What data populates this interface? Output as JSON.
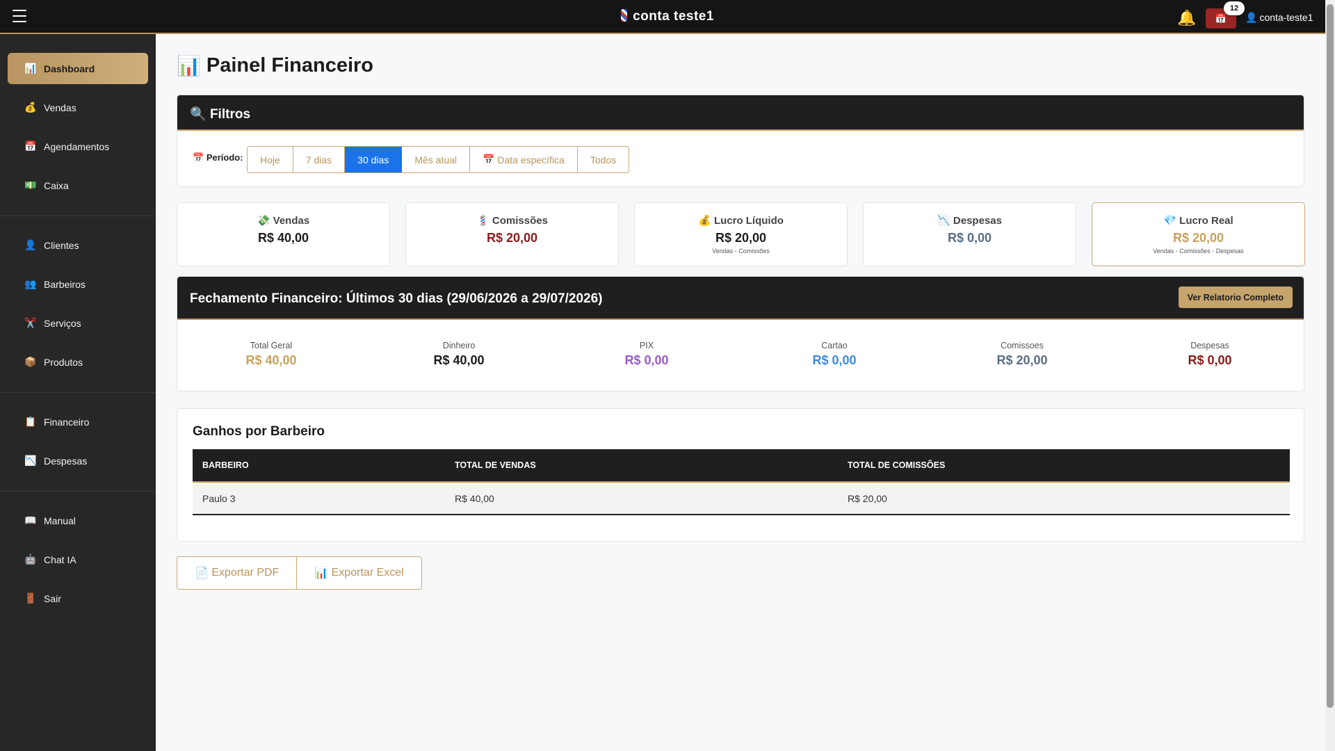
{
  "topbar": {
    "brand": "conta teste1",
    "notifications_count": "12",
    "user": "conta-teste1"
  },
  "sidebar": {
    "items": [
      {
        "label": "Dashboard",
        "icon": "bar-chart-icon",
        "glyph": "📊",
        "active": true
      },
      {
        "label": "Vendas",
        "icon": "money-bag-icon",
        "glyph": "💰"
      },
      {
        "label": "Agendamentos",
        "icon": "calendar-icon",
        "glyph": "📅"
      },
      {
        "label": "Caixa",
        "icon": "cash-icon",
        "glyph": "💵"
      },
      {
        "label": "Clientes",
        "icon": "user-icon",
        "glyph": "👤"
      },
      {
        "label": "Barbeiros",
        "icon": "users-icon",
        "glyph": "👥"
      },
      {
        "label": "Serviços",
        "icon": "scissors-icon",
        "glyph": "✂️"
      },
      {
        "label": "Produtos",
        "icon": "package-icon",
        "glyph": "📦"
      },
      {
        "label": "Financeiro",
        "icon": "clipboard-icon",
        "glyph": "📋"
      },
      {
        "label": "Despesas",
        "icon": "chart-down-icon",
        "glyph": "📉"
      },
      {
        "label": "Manual",
        "icon": "book-icon",
        "glyph": "📖"
      },
      {
        "label": "Chat IA",
        "icon": "robot-icon",
        "glyph": "🤖"
      },
      {
        "label": "Sair",
        "icon": "door-icon",
        "glyph": "🚪"
      }
    ]
  },
  "main": {
    "title": "Painel Financeiro",
    "filters": {
      "title": "Filtros",
      "period_label": "Período:",
      "options": [
        "Hoje",
        "7 dias",
        "30 dias",
        "Mês atual",
        "Data específica",
        "Todos"
      ],
      "selected": "30 dias"
    },
    "stats": [
      {
        "label": "Vendas",
        "value": "R$ 40,00",
        "glyph": "💸",
        "color": "#1d1d1d"
      },
      {
        "label": "Comissões",
        "value": "R$ 20,00",
        "glyph": "💈",
        "color": "#8b1a1a"
      },
      {
        "label": "Lucro Líquido",
        "value": "R$ 20,00",
        "note": "Vendas - Comissões",
        "glyph": "💰",
        "color": "#1d1d1d"
      },
      {
        "label": "Despesas",
        "value": "R$ 0,00",
        "glyph": "📉",
        "color": "#5a6e84"
      },
      {
        "label": "Lucro Real",
        "value": "R$ 20,00",
        "note": "Vendas - Comissões - Despesas",
        "glyph": "💎",
        "color": "#c8a15c"
      }
    ],
    "closing": {
      "title": "Fechamento Financeiro: Últimos 30 dias (29/06/2026 a 29/07/2026)",
      "report_button": "Ver Relatorio Completo",
      "metrics": [
        {
          "label": "Total Geral",
          "value": "R$ 40,00",
          "color": "#c8a15c"
        },
        {
          "label": "Dinheiro",
          "value": "R$ 40,00",
          "color": "#1d1d1d"
        },
        {
          "label": "PIX",
          "value": "R$ 0,00",
          "color": "#9b59d0"
        },
        {
          "label": "Cartao",
          "value": "R$ 0,00",
          "color": "#3c8ae0"
        },
        {
          "label": "Comissoes",
          "value": "R$ 20,00",
          "color": "#5a6e84"
        },
        {
          "label": "Despesas",
          "value": "R$ 0,00",
          "color": "#8b1a1a"
        }
      ]
    },
    "earnings": {
      "title": "Ganhos por Barbeiro",
      "columns": [
        "BARBEIRO",
        "TOTAL DE VENDAS",
        "TOTAL DE COMISSÕES"
      ],
      "rows": [
        [
          "Paulo 3",
          "R$ 40,00",
          "R$ 20,00"
        ]
      ]
    },
    "export": {
      "pdf": "Exportar PDF",
      "excel": "Exportar Excel"
    }
  }
}
